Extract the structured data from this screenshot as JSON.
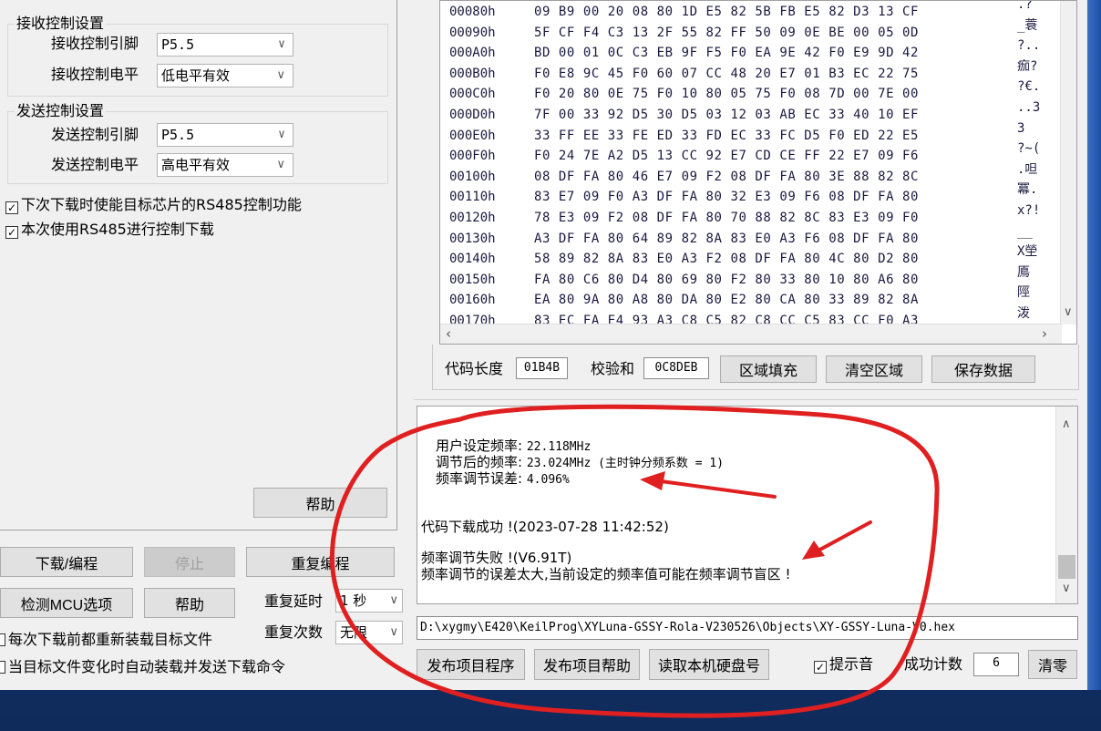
{
  "receive_group": {
    "title": "接收控制设置",
    "pin_label": "接收控制引脚",
    "pin_value": "P5.5",
    "level_label": "接收控制电平",
    "level_value": "低电平有效"
  },
  "send_group": {
    "title": "发送控制设置",
    "pin_label": "发送控制引脚",
    "pin_value": "P5.5",
    "level_label": "发送控制电平",
    "level_value": "高电平有效"
  },
  "options": {
    "enable_rs485_next": "下次下载时使能目标芯片的RS485控制功能",
    "use_rs485_now": "本次使用RS485进行控制下载"
  },
  "left_buttons": {
    "help_top": "帮助",
    "download": "下载/编程",
    "stop": "停止",
    "repeat_program": "重复编程",
    "detect_mcu": "检测MCU选项",
    "help": "帮助",
    "repeat_delay_label": "重复延时",
    "repeat_delay_value": "1 秒",
    "repeat_count_label": "重复次数",
    "repeat_count_value": "无限",
    "reload_each": "每次下载前都重新装载目标文件",
    "auto_reload": "当目标文件变化时自动装载并发送下载命令"
  },
  "hex_view": {
    "rows": [
      {
        "addr": "00080h",
        "bytes": "09 B9 00 20 08 80 1D E5 82 5B FB E5 82 D3 13 CF",
        "ascii": ".?"
      },
      {
        "addr": "00090h",
        "bytes": "5F CF F4 C3 13 2F 55 82 FF 50 09 0E BE 00 05 0D",
        "ascii": "_蓑"
      },
      {
        "addr": "000A0h",
        "bytes": "BD 00 01 0C C3 EB 9F F5 F0 EA 9E 42 F0 E9 9D 42",
        "ascii": "?.."
      },
      {
        "addr": "000B0h",
        "bytes": "F0 E8 9C 45 F0 60 07 CC 48 20 E7 01 B3 EC 22 75",
        "ascii": "痂?"
      },
      {
        "addr": "000C0h",
        "bytes": "F0 20 80 0E 75 F0 10 80 05 75 F0 08 7D 00 7E 00",
        "ascii": "?€."
      },
      {
        "addr": "000D0h",
        "bytes": "7F 00 33 92 D5 30 D5 03 12 03 AB EC 33 40 10 EF",
        "ascii": "..3"
      },
      {
        "addr": "000E0h",
        "bytes": "33 FF EE 33 FE ED 33 FD EC 33 FC D5 F0 ED 22 E5",
        "ascii": "3"
      },
      {
        "addr": "000F0h",
        "bytes": "F0 24 7E A2 D5 13 CC 92 E7 CD CE FF 22 E7 09 F6",
        "ascii": "?~("
      },
      {
        "addr": "00100h",
        "bytes": "08 DF FA 80 46 E7 09 F2 08 DF FA 80 3E 88 82 8C",
        "ascii": ".呾"
      },
      {
        "addr": "00110h",
        "bytes": "83 E7 09 F0 A3 DF FA 80 32 E3 09 F6 08 DF FA 80",
        "ascii": "冪."
      },
      {
        "addr": "00120h",
        "bytes": "78 E3 09 F2 08 DF FA 80 70 88 82 8C 83 E3 09 F0",
        "ascii": "x?!"
      },
      {
        "addr": "00130h",
        "bytes": "A3 DF FA 80 64 89 82 8A 83 E0 A3 F6 08 DF FA 80",
        "ascii": "__"
      },
      {
        "addr": "00140h",
        "bytes": "58 89 82 8A 83 E0 A3 F2 08 DF FA 80 4C 80 D2 80",
        "ascii": "X塋"
      },
      {
        "addr": "00150h",
        "bytes": "FA 80 C6 80 D4 80 69 80 F2 80 33 80 10 80 A6 80",
        "ascii": "鳫"
      },
      {
        "addr": "00160h",
        "bytes": "EA 80 9A 80 A8 80 DA 80 E2 80 CA 80 33 89 82 8A",
        "ascii": "陘"
      },
      {
        "addr": "00170h",
        "bytes": "83 EC FA E4 93 A3 C8 C5 82 C8 CC C5 83 CC F0 A3",
        "ascii": "泼"
      }
    ]
  },
  "hex_footer": {
    "code_length_label": "代码长度",
    "code_length_value": "01B4B",
    "checksum_label": "校验和",
    "checksum_value": "0C8DEB",
    "fill_button": "区域填充",
    "clear_button": "清空区域",
    "save_button": "保存数据"
  },
  "log": {
    "line1_label": "用户设定频率:",
    "line1_value": "22.118MHz",
    "line2_label": "调节后的频率:",
    "line2_value": "23.024MHz (主时钟分频系数 = 1)",
    "line3_label": "频率调节误差:",
    "line3_value": "4.096%",
    "line4": "代码下载成功 !(2023-07-28 11:42:52)",
    "line5": "频率调节失败 !(V6.91T)",
    "line6": "频率调节的误差太大,当前设定的频率值可能在频率调节盲区 !"
  },
  "file_path": "D:\\xygmy\\E420\\KeilProg\\XYLuna-GSSY-Rola-V230526\\Objects\\XY-GSSY-Luna-V0.hex",
  "bottom_bar": {
    "publish_program": "发布项目程序",
    "publish_help": "发布项目帮助",
    "read_disk": "读取本机硬盘号",
    "beep_label": "提示音",
    "success_label": "成功计数",
    "success_value": "6",
    "clear_count": "清零"
  },
  "colors": {
    "window_bg": "#f0f0f0",
    "hex_text": "#1a1a40",
    "annotation_red": "#e02020"
  }
}
